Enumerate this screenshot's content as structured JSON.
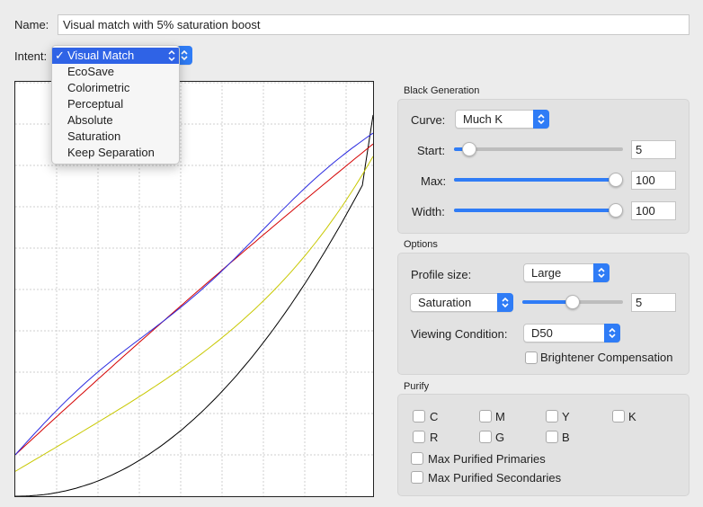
{
  "name": {
    "label": "Name:",
    "value": "Visual match with 5% saturation boost"
  },
  "intent": {
    "label": "Intent:",
    "menu": [
      {
        "label": "Visual Match",
        "selected": true
      },
      {
        "label": "EcoSave"
      },
      {
        "label": "Colorimetric"
      },
      {
        "label": "Perceptual"
      },
      {
        "label": "Absolute"
      },
      {
        "label": "Saturation"
      },
      {
        "label": "Keep Separation"
      }
    ],
    "check_glyph": "✓"
  },
  "black_generation": {
    "title": "Black Generation",
    "curve": {
      "label": "Curve:",
      "value": "Much K"
    },
    "start": {
      "label": "Start:",
      "value": "5",
      "level": 0.05
    },
    "max": {
      "label": "Max:",
      "value": "100",
      "level": 1.0
    },
    "width": {
      "label": "Width:",
      "value": "100",
      "level": 1.0
    }
  },
  "options": {
    "title": "Options",
    "profile_size": {
      "label": "Profile size:",
      "value": "Large"
    },
    "adjust": {
      "value": "Saturation",
      "amount": "5",
      "level": 0.5
    },
    "viewing_condition": {
      "label": "Viewing Condition:",
      "value": "D50"
    },
    "brightener": {
      "label": "Brightener Compensation",
      "checked": false
    }
  },
  "purify": {
    "title": "Purify",
    "row1": [
      {
        "label": "C",
        "checked": false
      },
      {
        "label": "M",
        "checked": false
      },
      {
        "label": "Y",
        "checked": false
      },
      {
        "label": "K",
        "checked": false
      }
    ],
    "row2": [
      {
        "label": "R",
        "checked": false
      },
      {
        "label": "G",
        "checked": false
      },
      {
        "label": "B",
        "checked": false
      }
    ],
    "max_primaries": {
      "label": "Max Purified Primaries",
      "checked": false
    },
    "max_secondaries": {
      "label": "Max Purified Secondaries",
      "checked": false
    }
  },
  "colors": {
    "accent": "#2f7cf6",
    "menu_highlight": "#2f63e6",
    "curve_black": "#000000",
    "curve_red": "#d40000",
    "curve_blue": "#2a2ae0",
    "curve_yellow": "#c8c800",
    "grid": "#cfcfcf"
  }
}
